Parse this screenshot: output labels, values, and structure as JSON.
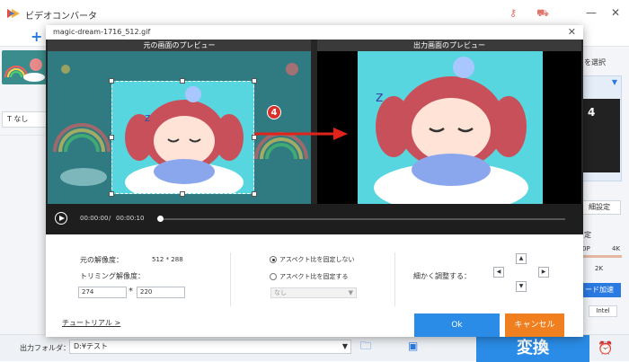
{
  "app": {
    "title": "ビデオコンバータ",
    "colors": {
      "accent": "#2a7ae2",
      "convert": "#2a8ce6",
      "cancel": "#f07f1f",
      "badge": "#d9302c"
    }
  },
  "toolbar": {
    "add_label": "+"
  },
  "left": {
    "subtitle_label": "T なし"
  },
  "right_panel": {
    "select_label": "を選択",
    "settings_label": "細設定",
    "fixed_label": "定",
    "quality_4k": "4K",
    "quality_p": "0P",
    "quality_2k": "2K",
    "accel_label": "ード加速",
    "intel_label": "Intel"
  },
  "dialog": {
    "title": "magic-dream-1716_512.gif",
    "source_preview_label": "元の画面のプレビュー",
    "output_preview_label": "出力画面のプレビュー",
    "step_badge": "4",
    "time_current": "00:00:00",
    "time_separator": "/",
    "time_total": "00:00:10",
    "original_resolution_label": "元の解像度：",
    "original_resolution_value": "512 * 288",
    "trim_resolution_label": "トリミング解像度：",
    "trim_width": "274",
    "trim_times": "*",
    "trim_height": "220",
    "aspect_free_label": "アスペクト比を固定しない",
    "aspect_fixed_label": "アスペクト比を固定する",
    "ratio_select_value": "なし",
    "fine_adjust_label": "細かく調整する：",
    "tutorial_label": "チュートリアル >",
    "ok_label": "Ok",
    "cancel_label": "キャンセル"
  },
  "footer": {
    "output_folder_label": "出力フォルダ：",
    "output_folder_value": "D:¥テスト",
    "convert_label": "変換"
  }
}
